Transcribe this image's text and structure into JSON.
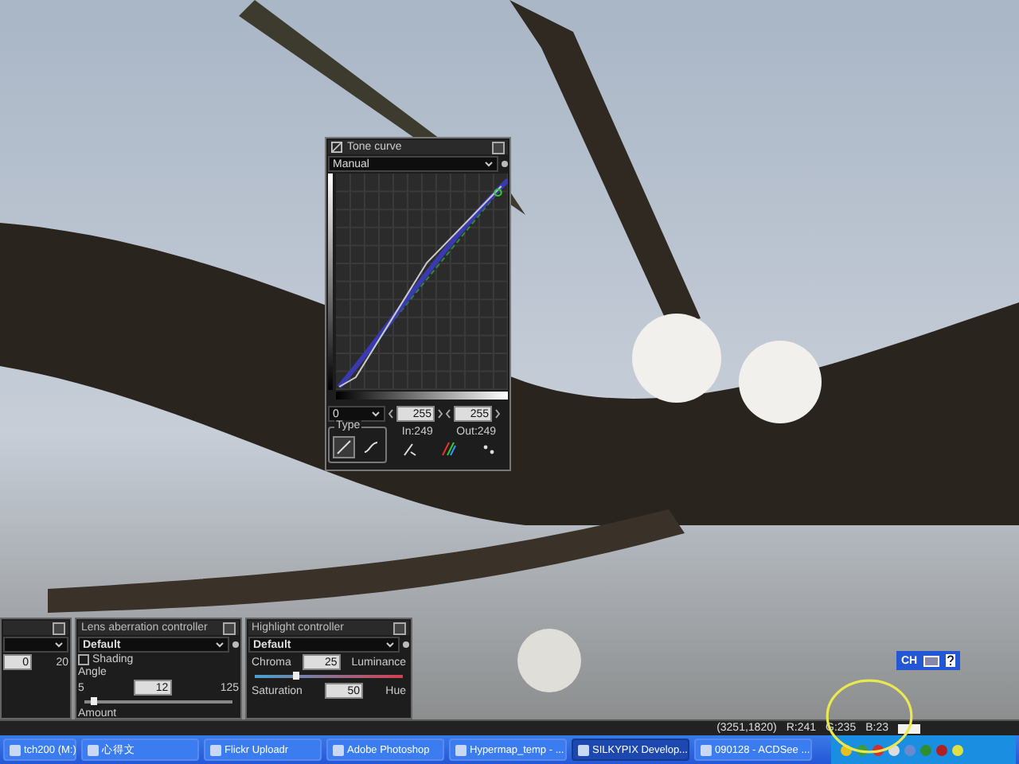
{
  "tone_curve": {
    "title": "Tone curve",
    "preset": "Manual",
    "channel": "0",
    "in_field": "255",
    "out_field": "255",
    "in_reading": "In:249",
    "out_reading": "Out:249",
    "type_label": "Type"
  },
  "panels": [
    {
      "kind": "partial",
      "field": "0",
      "max": "20"
    },
    {
      "kind": "lens",
      "title": "Lens aberration controller",
      "preset": "Default",
      "checkbox_label": "Shading",
      "checked": false,
      "label_1": "Angle",
      "min": "5",
      "field": "12",
      "max": "125",
      "level": 0.06,
      "label_2": "Amount"
    },
    {
      "kind": "highlight",
      "title": "Highlight controller",
      "preset": "Default",
      "label_1": "Chroma",
      "field": "25",
      "label_right": "Luminance",
      "level": 0.28,
      "label_2": "Saturation",
      "field_2": "50",
      "label_right_2": "Hue"
    }
  ],
  "language_bar": {
    "label": "CH"
  },
  "status_bar": {
    "coords": "(3251,1820)",
    "r": "R:241",
    "g": "G:235",
    "b": "B:23"
  },
  "taskbar": [
    {
      "label": "tch200 (M:)",
      "selected": false
    },
    {
      "label": "心得文",
      "selected": false
    },
    {
      "label": "Flickr Uploadr",
      "selected": false
    },
    {
      "label": "Adobe Photoshop",
      "selected": false
    },
    {
      "label": "Hypermap_temp - ...",
      "selected": false
    },
    {
      "label": "SILKYPIX Develop...",
      "selected": true
    },
    {
      "label": "090128 - ACDSee ...",
      "selected": false
    }
  ]
}
